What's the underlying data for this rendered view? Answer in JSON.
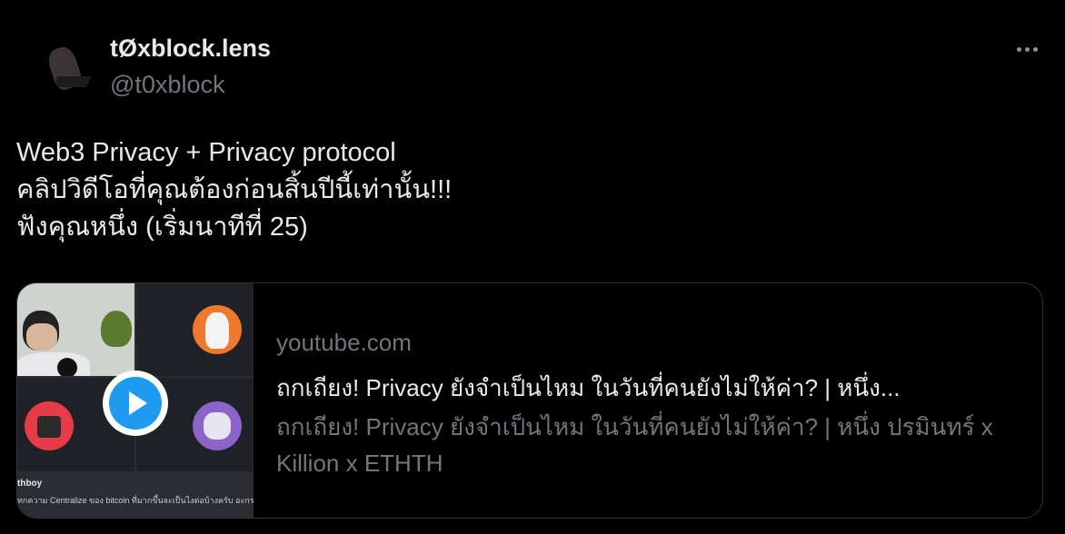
{
  "author": {
    "display_name": "tØxblock.lens",
    "handle": "@t0xblock"
  },
  "tweet": {
    "lines": [
      "Web3 Privacy + Privacy protocol",
      "คลิปวิดีโอที่คุณต้องก่อนสิ้นปีนี้เท่านั้น!!!",
      "ฟังคุณหนึ่ง (เริ่มนาทีที่ 25)"
    ]
  },
  "card": {
    "domain": "youtube.com",
    "title": "ถกเถียง! Privacy ยังจำเป็นไหม ในวันที่คนยังไม่ให้ค่า? | หนึ่ง...",
    "description": "ถกเถียง! Privacy ยังจำเป็นไหม ในวันที่คนยังไม่ให้ค่า? | หนึ่ง ปรมินทร์ x Killion x ETHTH",
    "thumbnail": {
      "caption_name": "thboy",
      "caption_text": "ทกความ Centralize ของ bitcoin ที่มากขึ้นจะเป็นไงต่อบ้างครับ อะกระแบบด"
    }
  },
  "icons": {
    "more": "more-horizontal-icon",
    "play": "play-icon"
  },
  "colors": {
    "background": "#000000",
    "text_primary": "#e7e9ea",
    "text_secondary": "#71767b",
    "border": "#2f3336",
    "accent": "#1d9bf0"
  }
}
